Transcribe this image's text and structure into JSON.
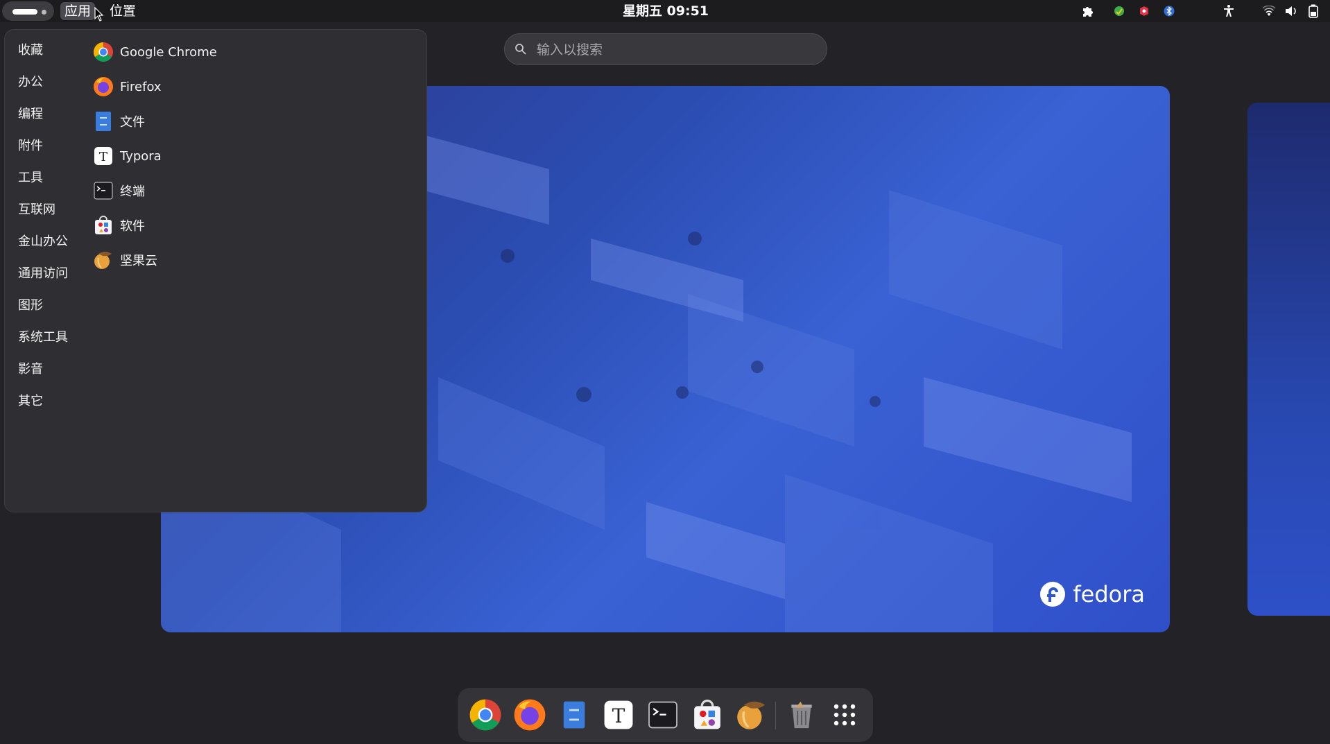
{
  "topbar": {
    "apps_menu": "应用",
    "places_menu": "位置",
    "clock": "星期五 09:51"
  },
  "search": {
    "placeholder": "输入以搜索"
  },
  "menu": {
    "categories": [
      "收藏",
      "办公",
      "编程",
      "附件",
      "工具",
      "互联网",
      "金山办公",
      "通用访问",
      "图形",
      "系统工具",
      "影音",
      "其它"
    ],
    "apps": [
      {
        "label": "Google Chrome",
        "icon": "chrome-icon"
      },
      {
        "label": "Firefox",
        "icon": "firefox-icon"
      },
      {
        "label": "文件",
        "icon": "files-icon"
      },
      {
        "label": "Typora",
        "icon": "typora-icon"
      },
      {
        "label": "终端",
        "icon": "terminal-icon"
      },
      {
        "label": "软件",
        "icon": "software-icon"
      },
      {
        "label": "坚果云",
        "icon": "nutstore-icon"
      }
    ]
  },
  "workspace": {
    "brand": "fedora"
  },
  "dock": {
    "items": [
      "chrome-icon",
      "firefox-icon",
      "files-icon",
      "typora-icon",
      "terminal-icon",
      "software-icon",
      "nutstore-icon",
      "trash-icon",
      "show-apps-icon"
    ]
  },
  "tray": [
    "extensions-icon",
    "tray-app-green-icon",
    "tray-app-red-icon",
    "bluetooth-icon",
    "accessibility-icon",
    "wifi-icon",
    "volume-icon",
    "battery-icon"
  ],
  "colors": {
    "panel": "#2e2e33",
    "topbar": "#1c1c1f",
    "accent_blue": "#3a62d4"
  }
}
